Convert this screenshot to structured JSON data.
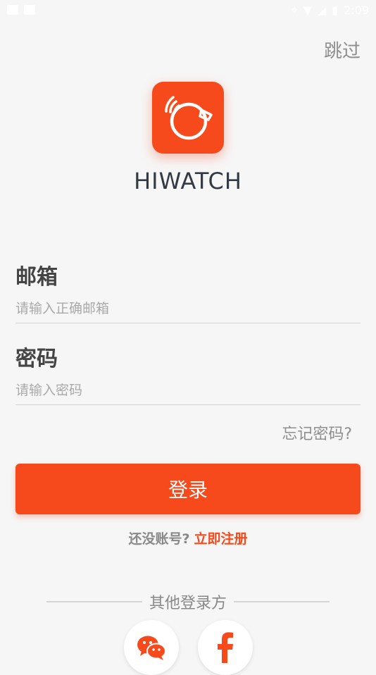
{
  "status_bar": {
    "time": "2:09"
  },
  "header": {
    "skip_label": "跳过"
  },
  "app": {
    "name": "HIWATCH"
  },
  "form": {
    "email_label": "邮箱",
    "email_placeholder": "请输入正确邮箱",
    "password_label": "密码",
    "password_placeholder": "请输入密码",
    "forgot_label": "忘记密码?",
    "login_label": "登录"
  },
  "register": {
    "prompt": "还没账号?",
    "link": "立即注册"
  },
  "other_login": {
    "label": "其他登录方",
    "providers": [
      {
        "name": "wechat-icon",
        "color": "#f64a1c"
      },
      {
        "name": "facebook-icon",
        "color": "#f64a1c"
      }
    ]
  },
  "colors": {
    "accent": "#f64a1c",
    "background": "#f6f6f6"
  }
}
